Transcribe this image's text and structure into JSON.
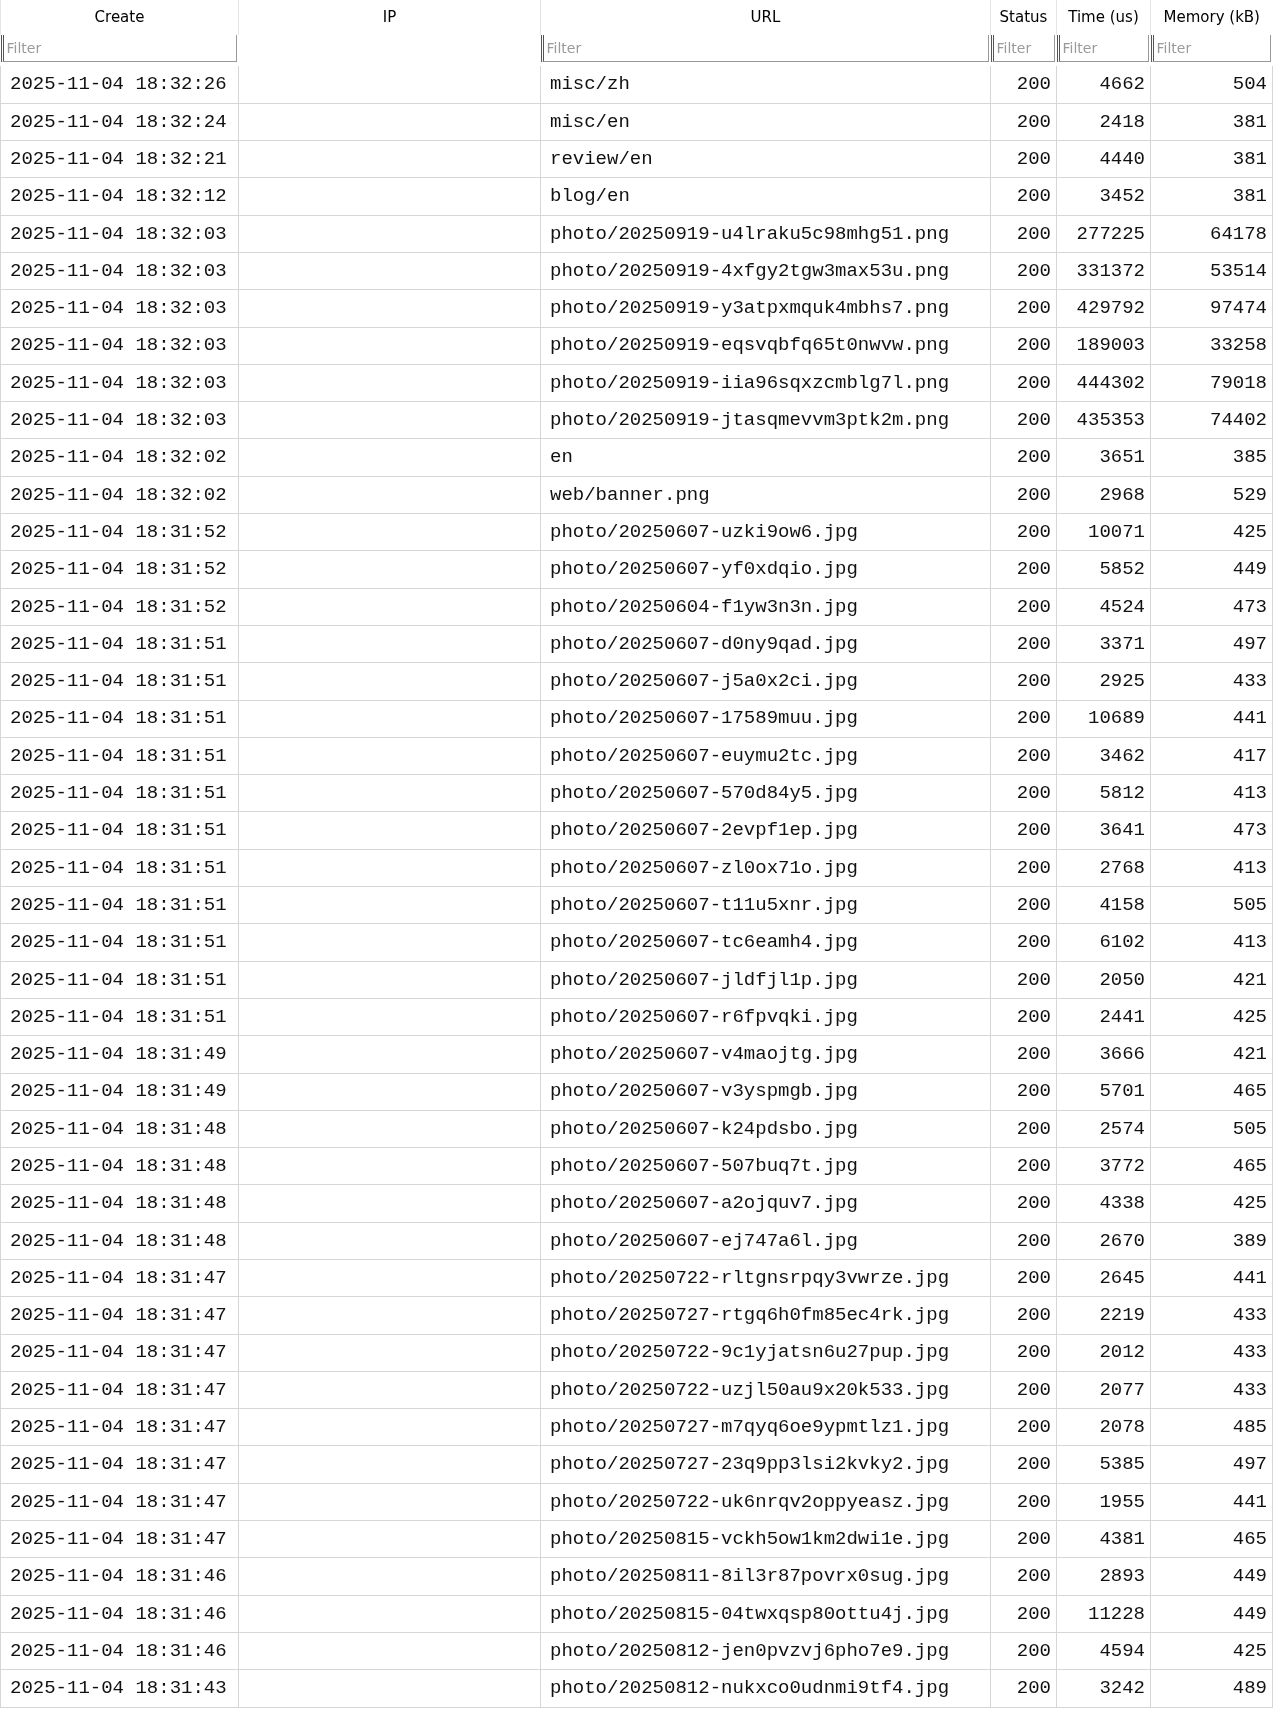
{
  "table": {
    "columns": [
      {
        "label": "Create",
        "filter_placeholder": "Filter",
        "kind": "text"
      },
      {
        "label": "IP",
        "kind": "text"
      },
      {
        "label": "URL",
        "filter_placeholder": "Filter",
        "kind": "text"
      },
      {
        "label": "Status",
        "filter_placeholder": "Filter",
        "kind": "number"
      },
      {
        "label": "Time (us)",
        "filter_placeholder": "Filter",
        "kind": "number"
      },
      {
        "label": "Memory (kB)",
        "filter_placeholder": "Filter",
        "kind": "number"
      }
    ],
    "rows": [
      [
        "2025-11-04 18:32:26",
        "",
        "misc/zh",
        "200",
        "4662",
        "504"
      ],
      [
        "2025-11-04 18:32:24",
        "",
        "misc/en",
        "200",
        "2418",
        "381"
      ],
      [
        "2025-11-04 18:32:21",
        "",
        "review/en",
        "200",
        "4440",
        "381"
      ],
      [
        "2025-11-04 18:32:12",
        "",
        "blog/en",
        "200",
        "3452",
        "381"
      ],
      [
        "2025-11-04 18:32:03",
        "",
        "photo/20250919-u4lraku5c98mhg51.png",
        "200",
        "277225",
        "64178"
      ],
      [
        "2025-11-04 18:32:03",
        "",
        "photo/20250919-4xfgy2tgw3max53u.png",
        "200",
        "331372",
        "53514"
      ],
      [
        "2025-11-04 18:32:03",
        "",
        "photo/20250919-y3atpxmquk4mbhs7.png",
        "200",
        "429792",
        "97474"
      ],
      [
        "2025-11-04 18:32:03",
        "",
        "photo/20250919-eqsvqbfq65t0nwvw.png",
        "200",
        "189003",
        "33258"
      ],
      [
        "2025-11-04 18:32:03",
        "",
        "photo/20250919-iia96sqxzcmblg7l.png",
        "200",
        "444302",
        "79018"
      ],
      [
        "2025-11-04 18:32:03",
        "",
        "photo/20250919-jtasqmevvm3ptk2m.png",
        "200",
        "435353",
        "74402"
      ],
      [
        "2025-11-04 18:32:02",
        "",
        "en",
        "200",
        "3651",
        "385"
      ],
      [
        "2025-11-04 18:32:02",
        "",
        "web/banner.png",
        "200",
        "2968",
        "529"
      ],
      [
        "2025-11-04 18:31:52",
        "",
        "photo/20250607-uzki9ow6.jpg",
        "200",
        "10071",
        "425"
      ],
      [
        "2025-11-04 18:31:52",
        "",
        "photo/20250607-yf0xdqio.jpg",
        "200",
        "5852",
        "449"
      ],
      [
        "2025-11-04 18:31:52",
        "",
        "photo/20250604-f1yw3n3n.jpg",
        "200",
        "4524",
        "473"
      ],
      [
        "2025-11-04 18:31:51",
        "",
        "photo/20250607-d0ny9qad.jpg",
        "200",
        "3371",
        "497"
      ],
      [
        "2025-11-04 18:31:51",
        "",
        "photo/20250607-j5a0x2ci.jpg",
        "200",
        "2925",
        "433"
      ],
      [
        "2025-11-04 18:31:51",
        "",
        "photo/20250607-17589muu.jpg",
        "200",
        "10689",
        "441"
      ],
      [
        "2025-11-04 18:31:51",
        "",
        "photo/20250607-euymu2tc.jpg",
        "200",
        "3462",
        "417"
      ],
      [
        "2025-11-04 18:31:51",
        "",
        "photo/20250607-570d84y5.jpg",
        "200",
        "5812",
        "413"
      ],
      [
        "2025-11-04 18:31:51",
        "",
        "photo/20250607-2evpf1ep.jpg",
        "200",
        "3641",
        "473"
      ],
      [
        "2025-11-04 18:31:51",
        "",
        "photo/20250607-zl0ox71o.jpg",
        "200",
        "2768",
        "413"
      ],
      [
        "2025-11-04 18:31:51",
        "",
        "photo/20250607-t11u5xnr.jpg",
        "200",
        "4158",
        "505"
      ],
      [
        "2025-11-04 18:31:51",
        "",
        "photo/20250607-tc6eamh4.jpg",
        "200",
        "6102",
        "413"
      ],
      [
        "2025-11-04 18:31:51",
        "",
        "photo/20250607-jldfjl1p.jpg",
        "200",
        "2050",
        "421"
      ],
      [
        "2025-11-04 18:31:51",
        "",
        "photo/20250607-r6fpvqki.jpg",
        "200",
        "2441",
        "425"
      ],
      [
        "2025-11-04 18:31:49",
        "",
        "photo/20250607-v4maojtg.jpg",
        "200",
        "3666",
        "421"
      ],
      [
        "2025-11-04 18:31:49",
        "",
        "photo/20250607-v3yspmgb.jpg",
        "200",
        "5701",
        "465"
      ],
      [
        "2025-11-04 18:31:48",
        "",
        "photo/20250607-k24pdsbo.jpg",
        "200",
        "2574",
        "505"
      ],
      [
        "2025-11-04 18:31:48",
        "",
        "photo/20250607-507buq7t.jpg",
        "200",
        "3772",
        "465"
      ],
      [
        "2025-11-04 18:31:48",
        "",
        "photo/20250607-a2ojquv7.jpg",
        "200",
        "4338",
        "425"
      ],
      [
        "2025-11-04 18:31:48",
        "",
        "photo/20250607-ej747a6l.jpg",
        "200",
        "2670",
        "389"
      ],
      [
        "2025-11-04 18:31:47",
        "",
        "photo/20250722-rltgnsrpqy3vwrze.jpg",
        "200",
        "2645",
        "441"
      ],
      [
        "2025-11-04 18:31:47",
        "",
        "photo/20250727-rtgq6h0fm85ec4rk.jpg",
        "200",
        "2219",
        "433"
      ],
      [
        "2025-11-04 18:31:47",
        "",
        "photo/20250722-9c1yjatsn6u27pup.jpg",
        "200",
        "2012",
        "433"
      ],
      [
        "2025-11-04 18:31:47",
        "",
        "photo/20250722-uzjl50au9x20k533.jpg",
        "200",
        "2077",
        "433"
      ],
      [
        "2025-11-04 18:31:47",
        "",
        "photo/20250727-m7qyq6oe9ypmtlz1.jpg",
        "200",
        "2078",
        "485"
      ],
      [
        "2025-11-04 18:31:47",
        "",
        "photo/20250727-23q9pp3lsi2kvky2.jpg",
        "200",
        "5385",
        "497"
      ],
      [
        "2025-11-04 18:31:47",
        "",
        "photo/20250722-uk6nrqv2oppyeasz.jpg",
        "200",
        "1955",
        "441"
      ],
      [
        "2025-11-04 18:31:47",
        "",
        "photo/20250815-vckh5ow1km2dwi1e.jpg",
        "200",
        "4381",
        "465"
      ],
      [
        "2025-11-04 18:31:46",
        "",
        "photo/20250811-8il3r87povrx0sug.jpg",
        "200",
        "2893",
        "449"
      ],
      [
        "2025-11-04 18:31:46",
        "",
        "photo/20250815-04twxqsp80ottu4j.jpg",
        "200",
        "11228",
        "449"
      ],
      [
        "2025-11-04 18:31:46",
        "",
        "photo/20250812-jen0pvzvj6pho7e9.jpg",
        "200",
        "4594",
        "425"
      ],
      [
        "2025-11-04 18:31:43",
        "",
        "photo/20250812-nukxco0udnmi9tf4.jpg",
        "200",
        "3242",
        "489"
      ]
    ]
  }
}
